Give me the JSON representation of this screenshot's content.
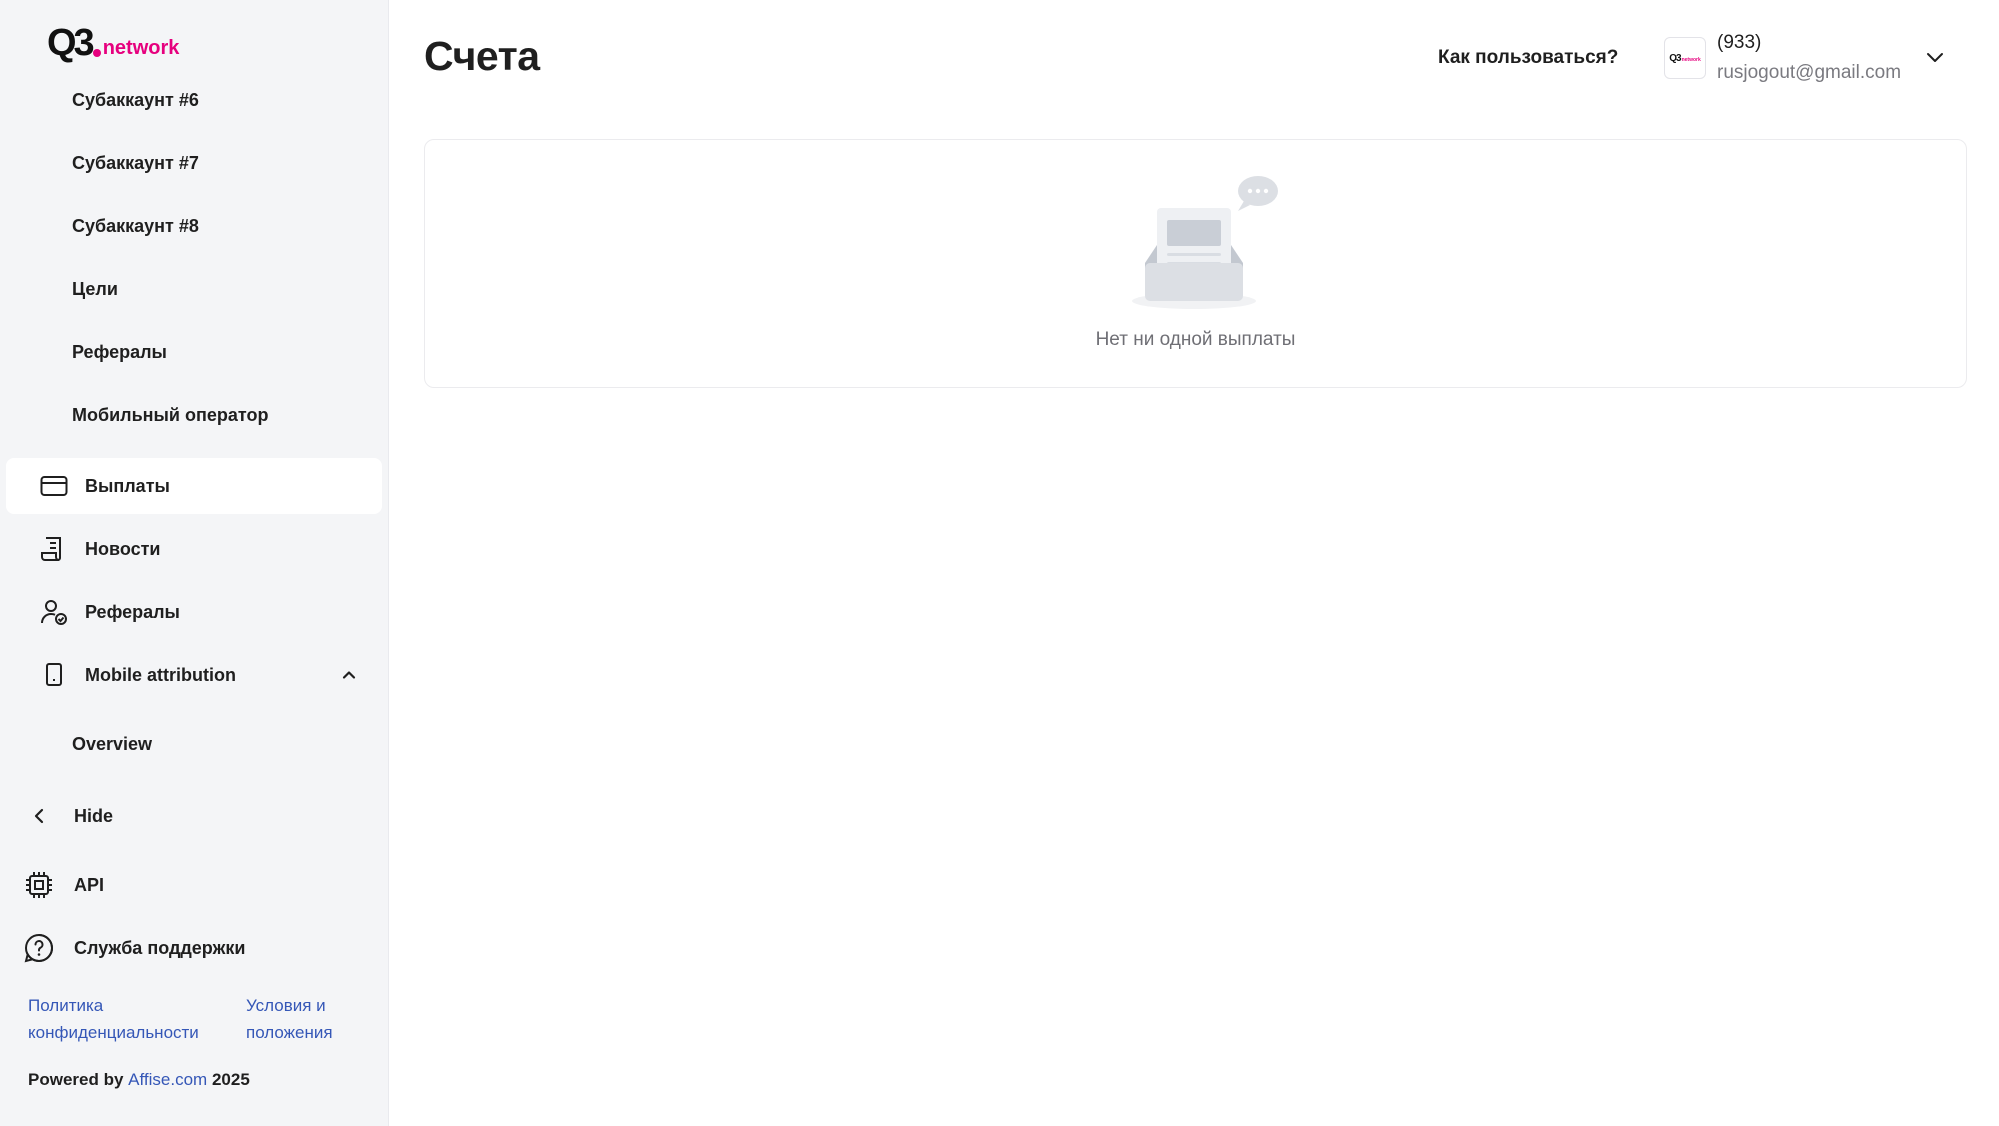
{
  "app": {
    "logo_text": "Q3",
    "logo_suffix": "network"
  },
  "sidebar": {
    "subitems_top": [
      {
        "label": "Субаккаунт #6"
      },
      {
        "label": "Субаккаунт #7"
      },
      {
        "label": "Субаккаунт #8"
      },
      {
        "label": "Цели"
      },
      {
        "label": "Рефералы"
      },
      {
        "label": "Мобильный оператор"
      }
    ],
    "items": [
      {
        "label": "Выплаты",
        "icon": "card-icon",
        "active": true
      },
      {
        "label": "Новости",
        "icon": "news-icon"
      },
      {
        "label": "Рефералы",
        "icon": "referral-icon"
      },
      {
        "label": "Mobile attribution",
        "icon": "mobile-icon",
        "expanded": true
      }
    ],
    "mobile_subitems": [
      {
        "label": "Overview"
      }
    ],
    "hide_label": "Hide",
    "api_label": "API",
    "support_label": "Служба поддержки",
    "footer": {
      "privacy_line1": "Политика",
      "privacy_line2": "конфиденциальности",
      "terms_line1": "Условия и",
      "terms_line2": "положения",
      "powered_prefix": "Powered by",
      "powered_link": "Affise.com",
      "powered_year": "2025"
    }
  },
  "header": {
    "title": "Счета",
    "how_to_label": "Как пользоваться?",
    "user": {
      "id": "(933)",
      "email": "rusjogout@gmail.com"
    }
  },
  "main": {
    "empty_state_text": "Нет ни одной выплаты"
  },
  "colors": {
    "brand_pink": "#e6007e",
    "link_blue": "#3557b7",
    "sidebar_bg": "#f4f5f7"
  }
}
